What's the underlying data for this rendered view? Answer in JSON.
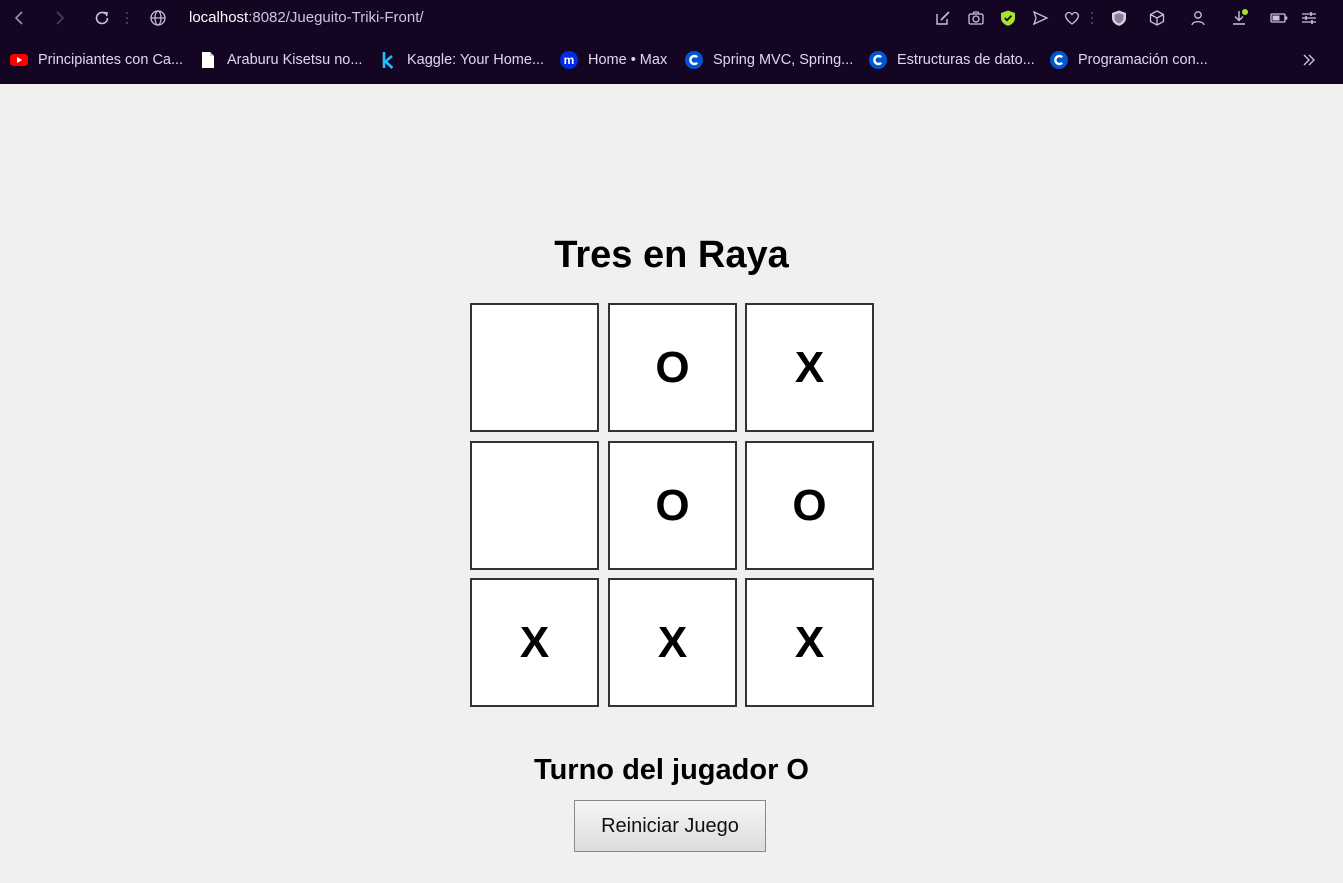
{
  "browser": {
    "url_host": "localhost",
    "url_path": ":8082/Jueguito-Triki-Front/",
    "bookmarks": [
      {
        "label": "Principiantes con Ca...",
        "icon": "youtube-icon"
      },
      {
        "label": "Araburu Kisetsu no...",
        "icon": "document-icon"
      },
      {
        "label": "Kaggle: Your Home...",
        "icon": "kaggle-icon"
      },
      {
        "label": "Home • Max",
        "icon": "max-icon"
      },
      {
        "label": "Spring MVC, Spring...",
        "icon": "coursera-icon"
      },
      {
        "label": "Estructuras de dato...",
        "icon": "coursera-icon"
      },
      {
        "label": "Programación con...",
        "icon": "coursera-icon"
      }
    ],
    "colors": {
      "chrome_bg": "#140622",
      "accent_green": "#a6e22e"
    }
  },
  "game": {
    "title": "Tres en Raya",
    "board": [
      "",
      "O",
      "X",
      "",
      "O",
      "O",
      "X",
      "X",
      "X"
    ],
    "status": "Turno del jugador O",
    "reset_label": "Reiniciar Juego"
  }
}
